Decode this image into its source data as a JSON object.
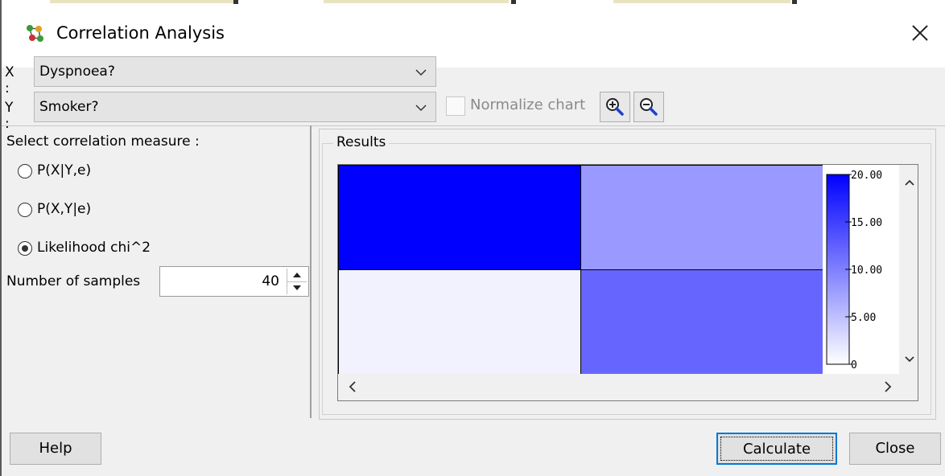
{
  "window": {
    "title": "Correlation Analysis",
    "icon": "network-nodes-icon",
    "close_icon": "close-icon"
  },
  "x_select": {
    "label": "X :",
    "value": "Dyspnoea?"
  },
  "y_select": {
    "label": "Y :",
    "value": "Smoker?"
  },
  "normalize": {
    "label": "Normalize chart",
    "checked": false,
    "enabled": false
  },
  "zoom": {
    "in_icon": "zoom-in-icon",
    "out_icon": "zoom-out-icon"
  },
  "measure": {
    "heading": "Select correlation measure :",
    "options": [
      {
        "label": "P(X|Y,e)",
        "selected": false
      },
      {
        "label": "P(X,Y|e)",
        "selected": false
      },
      {
        "label": "Likelihood chi^2",
        "selected": true
      }
    ]
  },
  "samples": {
    "label": "Number of samples",
    "value": "40"
  },
  "results": {
    "title": "Results"
  },
  "chart_data": {
    "type": "heatmap",
    "rows": 2,
    "cols": 2,
    "values": [
      [
        20.0,
        8.0
      ],
      [
        1.0,
        12.0
      ]
    ],
    "color_min": "#ffffff",
    "color_max": "#0000ff",
    "legend_ticks": [
      "20.00",
      "15.00",
      "10.00",
      "5.00",
      "0"
    ],
    "legend_range": [
      0,
      20
    ]
  },
  "buttons": {
    "help": "Help",
    "calculate": "Calculate",
    "close": "Close"
  }
}
